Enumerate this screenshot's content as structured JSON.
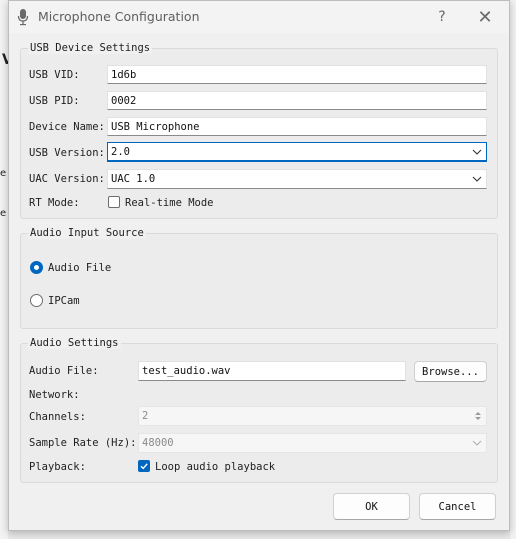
{
  "window": {
    "title": "Microphone Configuration",
    "help_label": "?",
    "close_label": "✕",
    "background_fragments": [
      "V",
      "e",
      "e"
    ]
  },
  "usb": {
    "group_title": "USB Device Settings",
    "vid_label": "USB VID:",
    "vid_value": "1d6b",
    "pid_label": "USB PID:",
    "pid_value": "0002",
    "name_label": "Device Name:",
    "name_value": "USB Microphone",
    "version_label": "USB Version:",
    "version_value": "2.0",
    "uac_label": "UAC Version:",
    "uac_value": "UAC 1.0",
    "rt_label": "RT Mode:",
    "rt_checkbox_label": "Real-time Mode",
    "rt_checked": false
  },
  "source": {
    "group_title": "Audio Input Source",
    "options": [
      {
        "label": "Audio File",
        "selected": true
      },
      {
        "label": "IPCam",
        "selected": false
      }
    ]
  },
  "audio": {
    "group_title": "Audio Settings",
    "file_label": "Audio File:",
    "file_value": "test_audio.wav",
    "browse_label": "Browse...",
    "network_label": "Network:",
    "channels_label": "Channels:",
    "channels_value": "2",
    "rate_label": "Sample Rate (Hz):",
    "rate_value": "48000",
    "playback_label": "Playback:",
    "loop_label": "Loop audio playback",
    "loop_checked": true
  },
  "footer": {
    "ok_label": "OK",
    "cancel_label": "Cancel"
  },
  "colors": {
    "accent": "#0067c0",
    "dialog_bg": "#f0f0f0"
  },
  "icons": [
    "microphone-icon",
    "help-icon",
    "close-icon",
    "chevron-down-icon",
    "checkmark-icon",
    "spin-arrows-icon"
  ]
}
